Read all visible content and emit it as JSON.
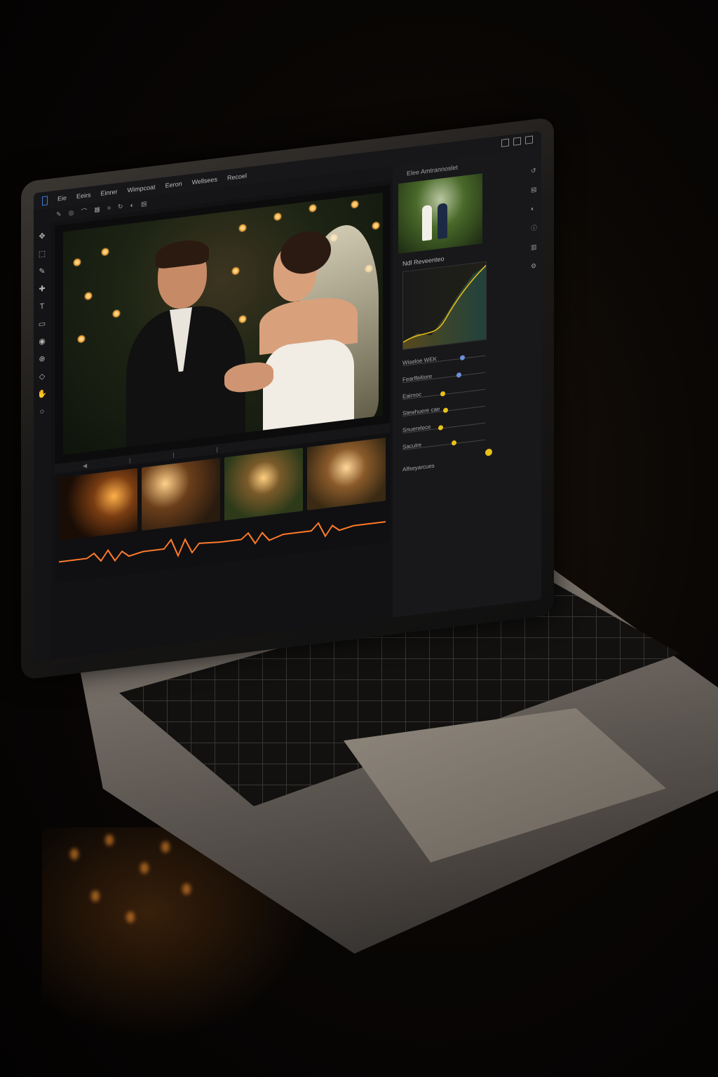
{
  "menubar": {
    "items": [
      "Eie",
      "Eeirs",
      "Einrer",
      "Wimpcoat",
      "Eeron",
      "Wellsees",
      "Recoel"
    ]
  },
  "panel": {
    "title": "Elee Amtrannoslet",
    "curves_label": "Ndl Reveenteo",
    "sliders": [
      {
        "label": "Wiseloe WEK",
        "value": "",
        "level": 0.72,
        "color": "#6b8fd8"
      },
      {
        "label": "Fearlfeitiore",
        "value": "",
        "level": 0.68,
        "color": "#6b8fd8"
      },
      {
        "label": "Eairnoc",
        "value": "",
        "level": 0.48,
        "color": "#e8c21a"
      },
      {
        "label": "Stewhuere cae",
        "value": "",
        "level": 0.52,
        "color": "#e8c21a"
      },
      {
        "label": "Snuerelece",
        "value": "",
        "level": 0.46,
        "color": "#e8c21a"
      },
      {
        "label": "Saculre",
        "value": "",
        "level": 0.62,
        "color": "#e8c21a"
      }
    ],
    "footer_label": "Alfseyarcues"
  },
  "colors": {
    "accent": "#e8c21a",
    "slider_blue": "#6b8fd8",
    "bokeh": "#ffb347",
    "waveform": "#ff7a2a"
  },
  "icons": [
    "app-icon",
    "window-controls",
    "tool-icons",
    "panel-icons"
  ]
}
